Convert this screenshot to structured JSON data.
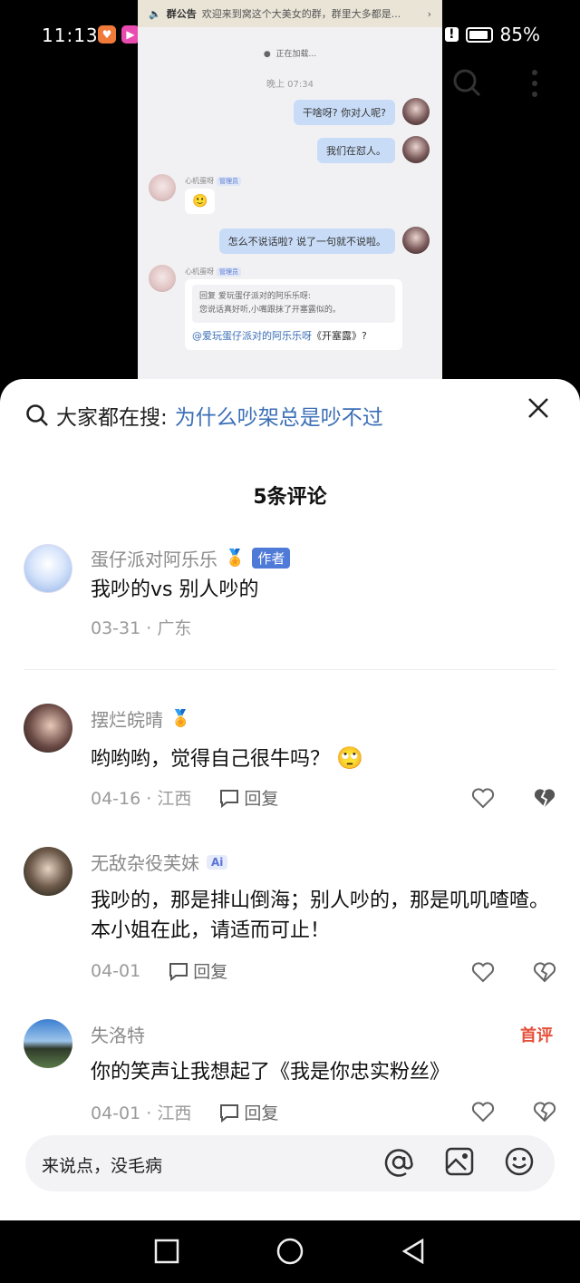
{
  "status_bar": {
    "time": "11:13",
    "battery": "85%"
  },
  "chat_screenshot": {
    "notice_label": "群公告",
    "notice_text": "欢迎来到窝这个大美女的群，群里大多都是...",
    "loading": "正在加载...",
    "timestamp": "晚上 07:34",
    "messages": [
      {
        "side": "right",
        "text": "干啥呀? 你对人呢?"
      },
      {
        "side": "right",
        "text": "我们在怼人。"
      },
      {
        "side": "left",
        "nickname": "心机蛋呀",
        "tag": "管理员",
        "text": "🙂"
      },
      {
        "side": "right",
        "text": "怎么不说话啦? 说了一句就不说啦。"
      },
      {
        "side": "left",
        "nickname": "心机蛋呀",
        "tag": "管理员",
        "quote_line1": "回复 爱玩蛋仔派对的阿乐乐呀:",
        "quote_line2": "您说话真好听,小嘴跟抹了开塞露似的。",
        "mention": "@爱玩蛋仔派对的阿乐乐呀",
        "text": "《开塞露》?"
      }
    ]
  },
  "search_bar": {
    "prefix": "大家都在搜:",
    "term": "为什么吵架总是吵不过"
  },
  "comments_header": "5条评论",
  "comments": [
    {
      "name": "蛋仔派对阿乐乐",
      "badge": "作者",
      "text": "我吵的vs 别人吵的",
      "meta": "03-31 · 广东"
    },
    {
      "name": "摆烂皖晴",
      "text": "哟哟哟，觉得自己很牛吗？",
      "meta": "04-16 · 江西",
      "reply": "回复"
    },
    {
      "name": "无敌杂役芙妹",
      "badge": "Ai",
      "text": "我吵的，那是排山倒海；别人吵的，那是叽叽喳喳。本小姐在此，请适而可止！",
      "meta": "04-01",
      "reply": "回复"
    },
    {
      "name": "失洛特",
      "tag": "首评",
      "text": "你的笑声让我想起了《我是你忠实粉丝》",
      "meta": "04-01 · 江西",
      "reply": "回复"
    }
  ],
  "input": {
    "placeholder": "来说点，没毛病"
  },
  "colors": {
    "accent": "#3b6fb6",
    "badge": "#4f7ad8",
    "first_tag": "#e5503a"
  }
}
